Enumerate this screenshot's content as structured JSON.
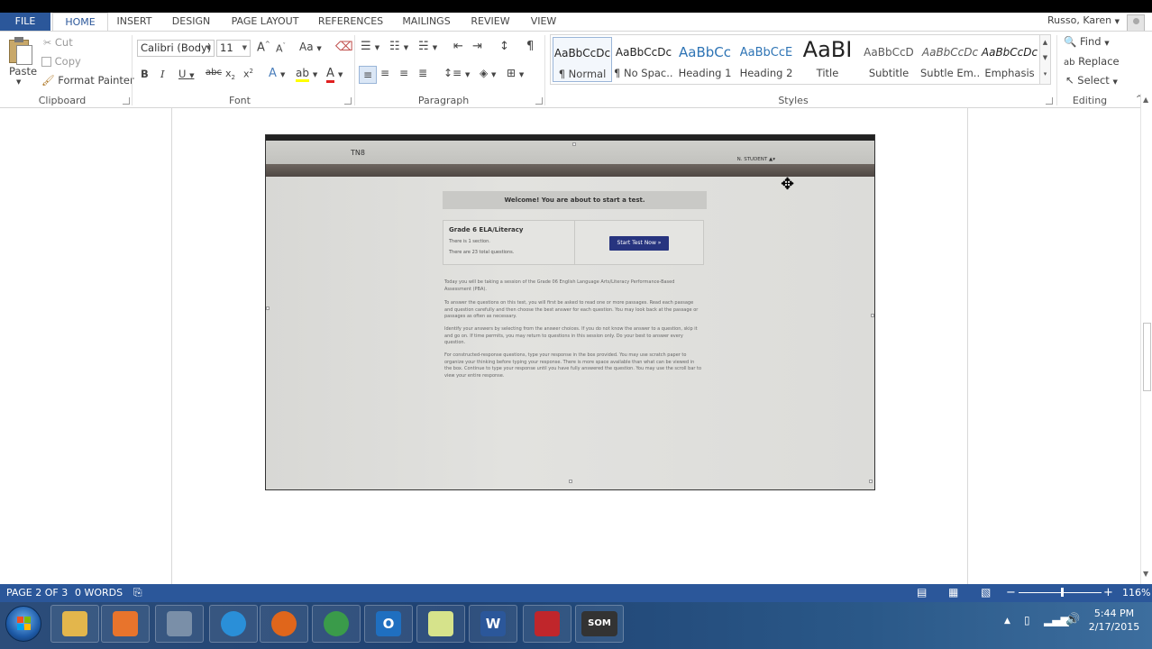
{
  "ribbon_tabs": [
    "FILE",
    "HOME",
    "INSERT",
    "DESIGN",
    "PAGE LAYOUT",
    "REFERENCES",
    "MAILINGS",
    "REVIEW",
    "VIEW"
  ],
  "user_name": "Russo, Karen",
  "clipboard": {
    "paste": "Paste",
    "cut": "Cut",
    "copy": "Copy",
    "format_painter": "Format Painter",
    "label": "Clipboard"
  },
  "font": {
    "name": "Calibri (Body)",
    "size": "11",
    "label": "Font"
  },
  "paragraph": {
    "label": "Paragraph"
  },
  "styles": {
    "label": "Styles",
    "items": [
      {
        "sample": "AaBbCcDc",
        "name": "¶ Normal"
      },
      {
        "sample": "AaBbCcDc",
        "name": "¶ No Spac..."
      },
      {
        "sample": "AaBbCc",
        "name": "Heading 1"
      },
      {
        "sample": "AaBbCcE",
        "name": "Heading 2"
      },
      {
        "sample": "AaBI",
        "name": "Title"
      },
      {
        "sample": "AaBbCcD",
        "name": "Subtitle"
      },
      {
        "sample": "AaBbCcDc",
        "name": "Subtle Em..."
      },
      {
        "sample": "AaBbCcDc",
        "name": "Emphasis"
      }
    ]
  },
  "editing": {
    "find": "Find",
    "replace": "Replace",
    "select": "Select",
    "label": "Editing"
  },
  "photo": {
    "tn8": "TN8",
    "student": "N. STUDENT",
    "welcome": "Welcome! You are about to start a test.",
    "grade": "Grade 6 ELA/Literacy",
    "sections": "There is 1 section.",
    "questions": "There are 23 total questions.",
    "start_button": "Start Test Now »",
    "para1": "Today you will be taking a session of the Grade 06 English Language Arts/Literacy Performance-Based Assessment (PBA).",
    "para2": "To answer the questions on this test, you will first be asked to read one or more passages. Read each passage and question carefully and then choose the best answer for each question. You may look back at the passage or passages as often as necessary.",
    "para3": "Identify your answers by selecting from the answer choices. If you do not know the answer to a question, skip it and go on. If time permits, you may return to questions in this session only. Do your best to answer every question.",
    "para4": "For constructed-response questions, type your response in the box provided. You may use scratch paper to organize your thinking before typing your response. There is more space available than what can be viewed in the box. Continue to type your response until you have fully answered the question. You may use the scroll bar to view your entire response."
  },
  "status": {
    "page": "PAGE 2 OF 3",
    "words": "0 WORDS",
    "zoom": "116%",
    "zoom_level_percent": 116
  },
  "clock": {
    "time": "5:44 PM",
    "date": "2/17/2015"
  },
  "taskbar_apps": [
    {
      "icon": "windows-explorer-icon",
      "color": "#e3b64c"
    },
    {
      "icon": "media-player-icon",
      "color": "#e8742c"
    },
    {
      "icon": "snipping-tool-icon",
      "color": "#7a8fa8"
    },
    {
      "icon": "internet-explorer-icon",
      "color": "#2a8fd8"
    },
    {
      "icon": "firefox-icon",
      "color": "#e0661b"
    },
    {
      "icon": "chrome-icon",
      "color": "#3a9b4a"
    },
    {
      "icon": "outlook-icon",
      "color": "#1f6fc0"
    },
    {
      "icon": "sticky-notes-icon",
      "color": "#d6e38b"
    },
    {
      "icon": "word-icon",
      "color": "#2b579a"
    },
    {
      "icon": "acrobat-icon",
      "color": "#c0262b"
    },
    {
      "icon": "som-icon",
      "color": "#333333"
    }
  ],
  "taskbar_labels": {
    "outlook": "O",
    "word": "W",
    "som": "SOM"
  }
}
